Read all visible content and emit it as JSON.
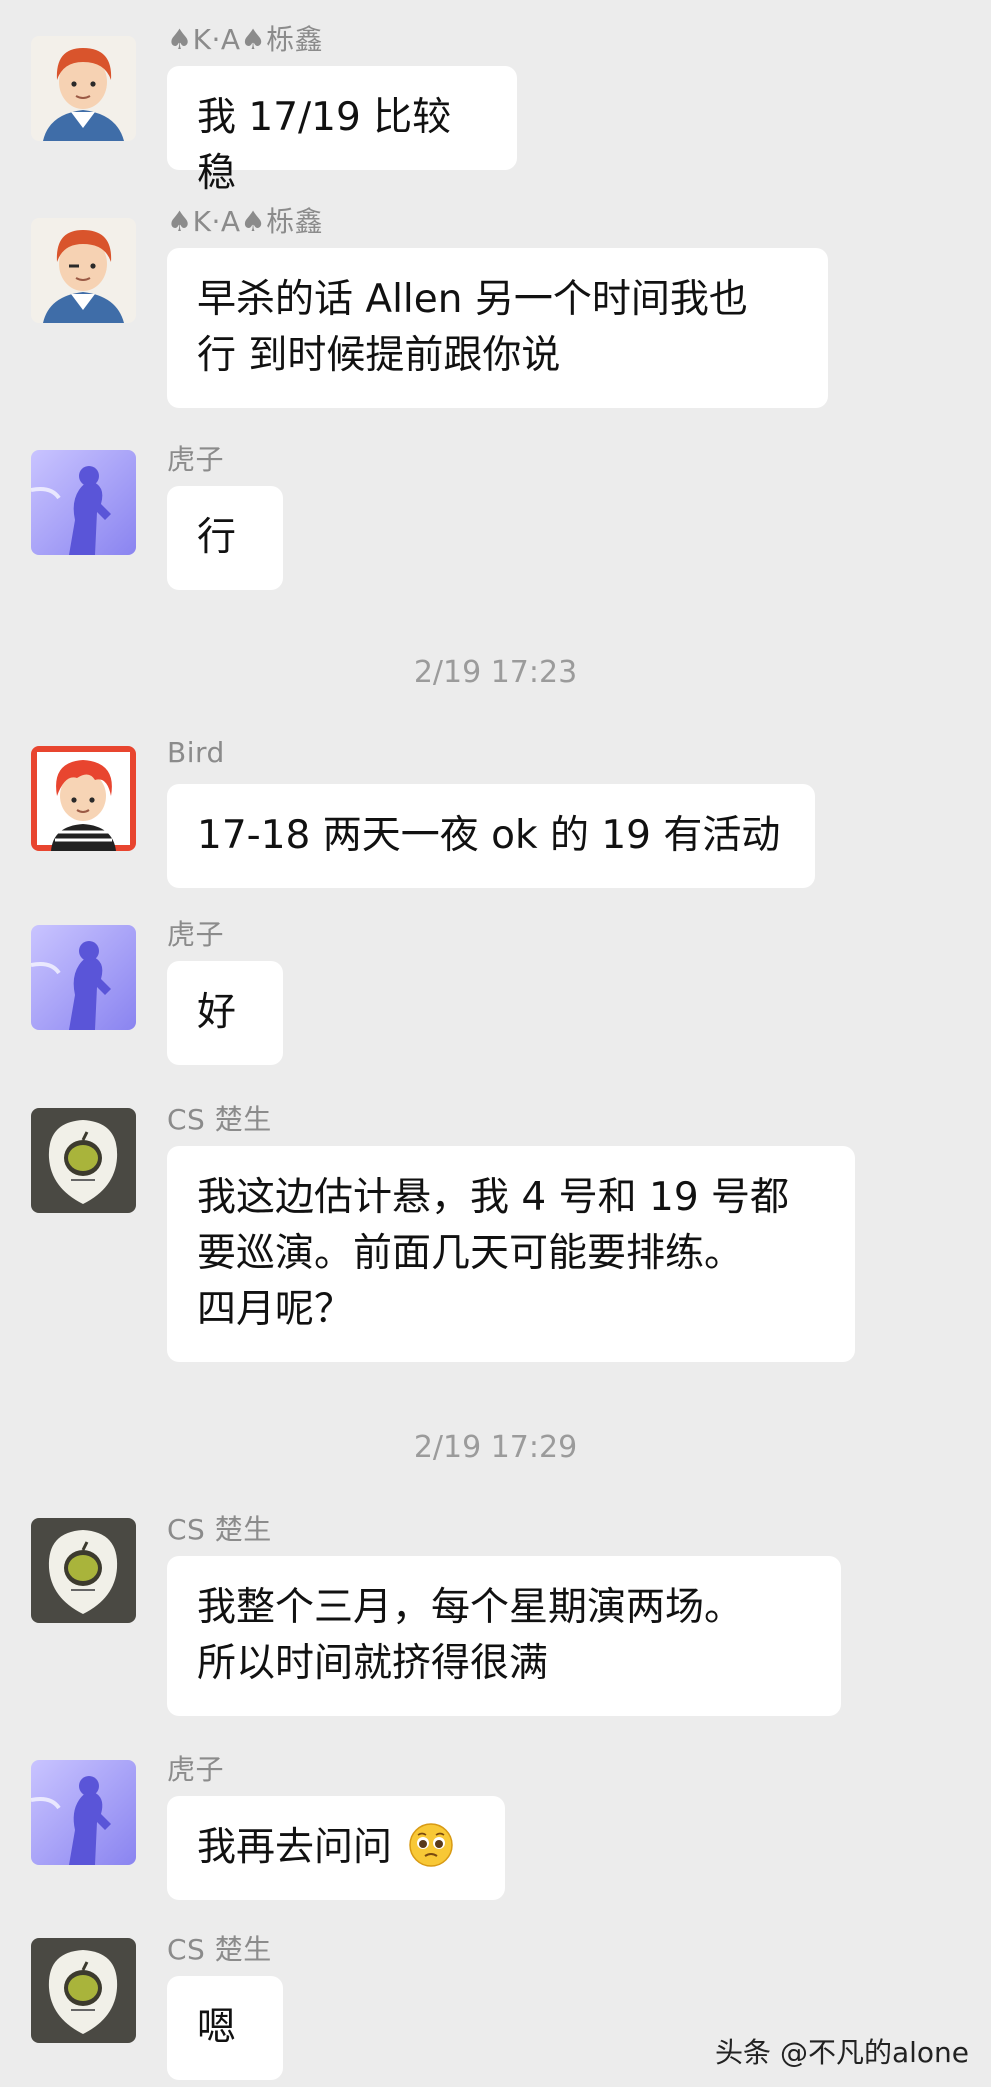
{
  "messages": [
    {
      "sender": "♠K·A♠栎鑫",
      "text": "我 17/19 比较稳",
      "avatar": "cartoon-boy-avatar"
    },
    {
      "sender": "♠K·A♠栎鑫",
      "text": "早杀的话 Allen 另一个时间我也\n行 到时候提前跟你说",
      "avatar": "cartoon-boy-avatar"
    },
    {
      "sender": "虎子",
      "text": "行",
      "avatar": "singer-silhouette-avatar"
    },
    {
      "sender": "Bird",
      "text": "17-18 两天一夜 ok 的 19 有活动",
      "avatar": "red-hair-boy-avatar"
    },
    {
      "sender": "虎子",
      "text": "好",
      "avatar": "singer-silhouette-avatar"
    },
    {
      "sender": "CS 楚生",
      "text": "我这边估计悬，我 4 号和 19 号都\n要巡演。前面几天可能要排练。\n四月呢？",
      "avatar": "guitar-pick-avatar"
    },
    {
      "sender": "CS 楚生",
      "text": "我整个三月，每个星期演两场。\n所以时间就挤得很满",
      "avatar": "guitar-pick-avatar"
    },
    {
      "sender": "虎子",
      "text": "我再去问问",
      "emoji": "pleading-face-emoji",
      "avatar": "singer-silhouette-avatar"
    },
    {
      "sender": "CS 楚生",
      "text": "嗯",
      "avatar": "guitar-pick-avatar"
    }
  ],
  "timestamps": [
    "2/19 17:23",
    "2/19 17:29"
  ],
  "watermark": "头条 @不凡的alone",
  "colors": {
    "background": "#ececec",
    "bubble": "#ffffff",
    "sender": "#8b8b8b",
    "timestamp": "#9b9b9b"
  }
}
